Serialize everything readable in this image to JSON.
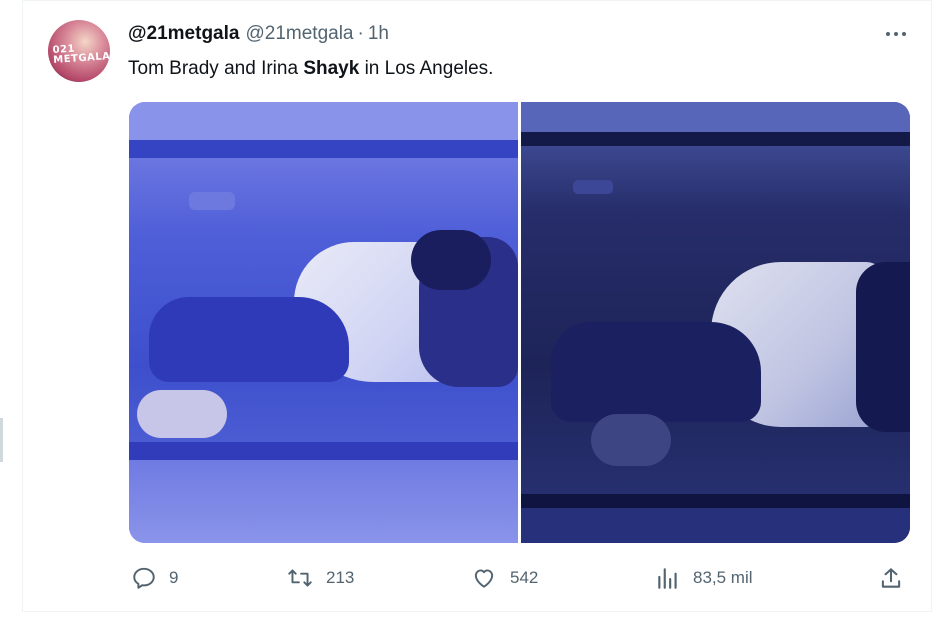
{
  "tweet": {
    "display_name": "@21metgala",
    "handle": "@21metgala",
    "separator": "·",
    "time": "1h",
    "avatar_text": "021\nMETGALA",
    "text_before": "Tom Brady and Irina ",
    "text_bold": "Shayk",
    "text_after": " in Los Angeles."
  },
  "actions": {
    "replies": "9",
    "retweets": "213",
    "likes": "542",
    "views": "83,5 mil"
  },
  "icons": {
    "more": "more-horizontal-icon",
    "reply": "reply-icon",
    "retweet": "retweet-icon",
    "like": "heart-icon",
    "views": "views-chart-icon",
    "share": "share-icon"
  },
  "colors": {
    "text_primary": "#0f1419",
    "text_secondary": "#536471",
    "divider": "#eff3f4"
  }
}
